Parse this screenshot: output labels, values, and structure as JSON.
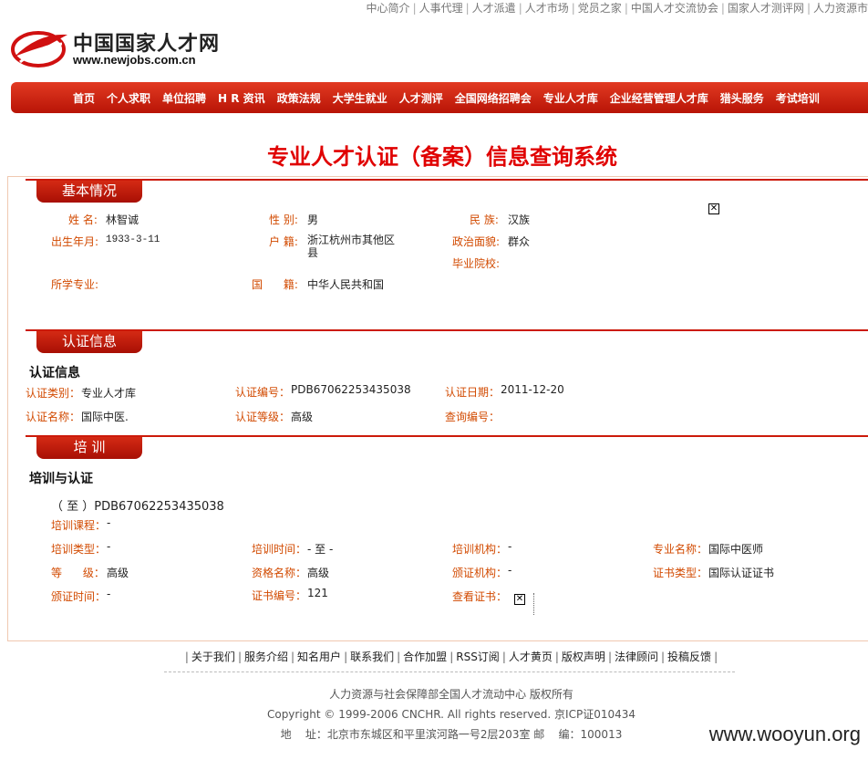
{
  "top_links": [
    "中心简介",
    "人事代理",
    "人才派遣",
    "人才市场",
    "党员之家",
    "中国人才交流协会",
    "国家人才测评网",
    "人力资源市"
  ],
  "logo": {
    "name": "中国国家人才网",
    "url": "www.newjobs.com.cn"
  },
  "nav": [
    "首页",
    "个人求职",
    "单位招聘",
    "H R 资讯",
    "政策法规",
    "大学生就业",
    "人才测评",
    "全国网络招聘会",
    "专业人才库",
    "企业经营管理人才库",
    "猎头服务",
    "考试培训"
  ],
  "page_title": "专业人才认证（备案）信息查询系统",
  "basic": {
    "tab": "基本情况",
    "name_label": "姓 名:",
    "name": "林智诚",
    "gender_label": "性 别:",
    "gender": "男",
    "ethnic_label": "民 族:",
    "ethnic": "汉族",
    "birth_label": "出生年月:",
    "birth": "1933-3-11",
    "hukou_label": "户 籍:",
    "hukou": "浙江杭州市其他区县",
    "politic_label": "政治面貌:",
    "politic": "群众",
    "school_label": "毕业院校:",
    "major_label": "所学专业:",
    "nation_label": "国      籍:",
    "nation": "中华人民共和国"
  },
  "cert": {
    "tab": "认证信息",
    "subtitle": "认证信息",
    "type_label": "认证类别：",
    "type": "专业人才库",
    "no_label": "认证编号：",
    "no": "PDB67062253435038",
    "date_label": "认证日期：",
    "date": "2011-12-20",
    "name_label": "认证名称：",
    "name": "国际中医.",
    "level_label": "认证等级：",
    "level": "高级",
    "query_label": "查询编号："
  },
  "training": {
    "tab": "培 训",
    "subtitle": "培训与认证",
    "period": "（ 至 ）PDB67062253435038",
    "course_label": "培训课程：",
    "course": "-",
    "ttype_label": "培训类型：",
    "ttype": "-",
    "ttime_label": "培训时间：",
    "ttime": "- 至 -",
    "org_label": "培训机构：",
    "org": "-",
    "spec_label": "专业名称：",
    "spec": "国际中医师",
    "level_label": "等      级：",
    "level": "高级",
    "qual_label": "资格名称：",
    "qual": "高级",
    "issuer_label": "颁证机构：",
    "issuer": "-",
    "certtype_label": "证书类型：",
    "certtype": "国际认证证书",
    "issuetime_label": "颁证时间：",
    "issuetime": "-",
    "certno_label": "证书编号：",
    "certno": "121",
    "view_label": "查看证书："
  },
  "footer": {
    "links": [
      "关于我们",
      "服务介绍",
      "知名用户",
      "联系我们",
      "合作加盟",
      "RSS订阅",
      "人才黄页",
      "版权声明",
      "法律顾问",
      "投稿反馈"
    ],
    "line1": "人力资源与社会保障部全国人才流动中心 版权所有",
    "line2": "Copyright © 1999-2006 CNCHR. All rights reserved. 京ICP证010434",
    "line3": "地    址：北京市东城区和平里滨河路一号2层203室 邮    编：100013"
  },
  "watermark": "www.wooyun.org",
  "colors": {
    "brand_red": "#cc1a0a",
    "label_orange": "#d24a00",
    "title_red": "#e00000"
  }
}
